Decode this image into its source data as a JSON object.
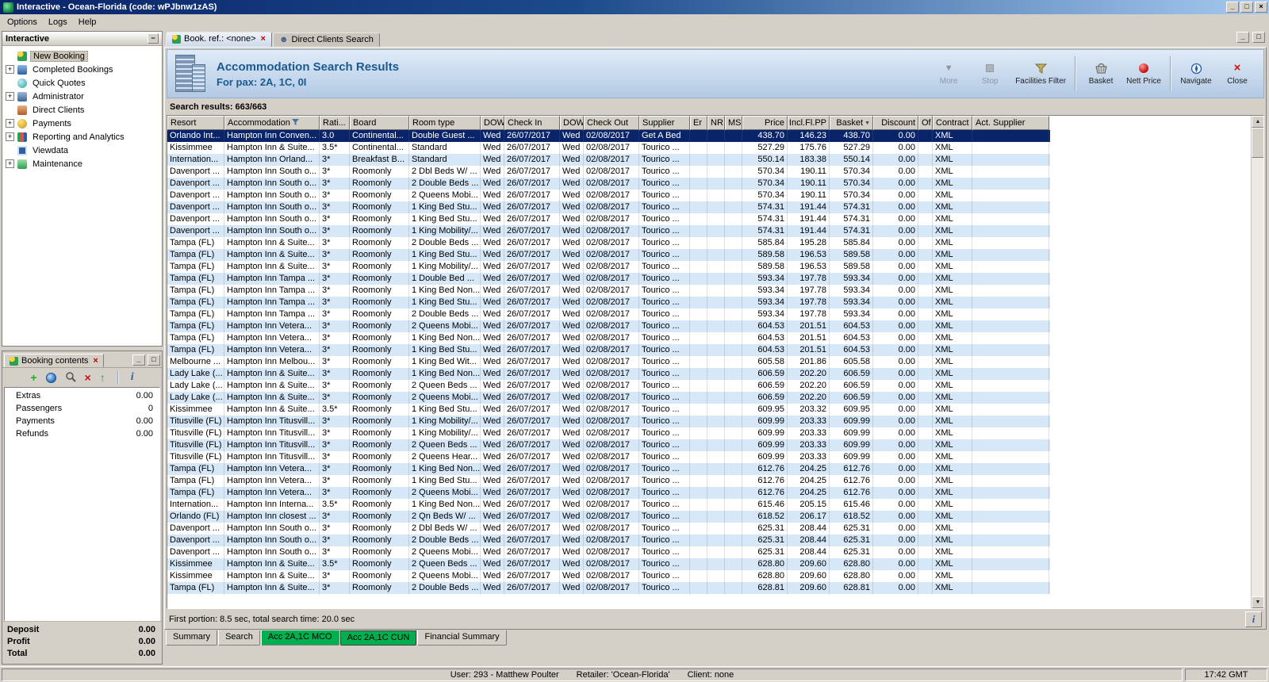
{
  "window": {
    "title": "Interactive - Ocean-Florida (code: wPJbnw1zAS)",
    "menu": [
      "Options",
      "Logs",
      "Help"
    ],
    "time": "17:42 GMT"
  },
  "sidebar": {
    "title": "Interactive",
    "items": [
      {
        "label": "New Booking",
        "icon": "new-booking",
        "expandable": false,
        "selected": true
      },
      {
        "label": "Completed Bookings",
        "icon": "completed-bookings",
        "expandable": true,
        "selected": false
      },
      {
        "label": "Quick Quotes",
        "icon": "quick-quotes",
        "expandable": false,
        "selected": false
      },
      {
        "label": "Administrator",
        "icon": "administrator",
        "expandable": true,
        "selected": false
      },
      {
        "label": "Direct Clients",
        "icon": "direct-clients",
        "expandable": false,
        "selected": false
      },
      {
        "label": "Payments",
        "icon": "payments",
        "expandable": true,
        "selected": false
      },
      {
        "label": "Reporting and Analytics",
        "icon": "reporting",
        "expandable": true,
        "selected": false
      },
      {
        "label": "Viewdata",
        "icon": "viewdata",
        "expandable": false,
        "selected": false
      },
      {
        "label": "Maintenance",
        "icon": "maintenance",
        "expandable": true,
        "selected": false
      }
    ]
  },
  "booking_contents": {
    "title": "Booking contents",
    "rows": [
      [
        "Extras",
        "0.00"
      ],
      [
        "Passengers",
        "0"
      ],
      [
        "Payments",
        "0.00"
      ],
      [
        "Refunds",
        "0.00"
      ]
    ],
    "totals": [
      [
        "Deposit",
        "0.00"
      ],
      [
        "Profit",
        "0.00"
      ],
      [
        "Total",
        "0.00"
      ]
    ]
  },
  "tabs": [
    {
      "label": "Book. ref.: <none>",
      "active": true,
      "closable": true,
      "icon": "palm-tree"
    },
    {
      "label": "Direct Clients Search",
      "active": false,
      "closable": false,
      "icon": "person"
    }
  ],
  "header": {
    "title": "Accommodation Search Results",
    "subtitle": "For pax: 2A, 1C, 0I",
    "toolbar": [
      {
        "label": "More",
        "icon": "more",
        "disabled": true,
        "sep_before": false
      },
      {
        "label": "Stop",
        "icon": "stop",
        "disabled": true,
        "sep_before": false
      },
      {
        "label": "Facilities Filter",
        "icon": "facilities-filter",
        "disabled": false,
        "sep_before": false
      },
      {
        "label": "Basket",
        "icon": "basket",
        "disabled": false,
        "sep_before": true
      },
      {
        "label": "Nett Price",
        "icon": "nett-price",
        "disabled": false,
        "sep_before": false
      },
      {
        "label": "Navigate",
        "icon": "navigate",
        "disabled": false,
        "sep_before": true
      },
      {
        "label": "Close",
        "icon": "close",
        "disabled": false,
        "sep_before": false
      }
    ]
  },
  "results": {
    "summary": "Search results: 663/663",
    "status": "First portion: 8.5 sec, total search time: 20.0 sec",
    "columns": [
      "Resort",
      "Accommodation",
      "Rati...",
      "Board",
      "Room type",
      "DOW",
      "Check In",
      "DOW",
      "Check Out",
      "Supplier",
      "Er",
      "NR",
      "MS",
      "Price",
      "Incl.Fl.PP",
      "Basket",
      "Discount",
      "Of",
      "Contract",
      "Act. Supplier"
    ],
    "rows": [
      [
        "Orlando Int...",
        "Hampton Inn Conven...",
        "3.0",
        "Continental...",
        "Double Guest ...",
        "Wed",
        "26/07/2017",
        "Wed",
        "02/08/2017",
        "Get A Bed",
        "438.70",
        "146.23",
        "438.70",
        "0.00",
        "XML"
      ],
      [
        "Kissimmee",
        "Hampton Inn & Suite...",
        "3.5*",
        "Continental...",
        "Standard",
        "Wed",
        "26/07/2017",
        "Wed",
        "02/08/2017",
        "Tourico ...",
        "527.29",
        "175.76",
        "527.29",
        "0.00",
        "XML"
      ],
      [
        "Internation...",
        "Hampton Inn Orland...",
        "3*",
        "Breakfast B...",
        "Standard",
        "Wed",
        "26/07/2017",
        "Wed",
        "02/08/2017",
        "Tourico ...",
        "550.14",
        "183.38",
        "550.14",
        "0.00",
        "XML"
      ],
      [
        "Davenport ...",
        "Hampton Inn South o...",
        "3*",
        "Roomonly",
        "2 Dbl Beds W/ ...",
        "Wed",
        "26/07/2017",
        "Wed",
        "02/08/2017",
        "Tourico ...",
        "570.34",
        "190.11",
        "570.34",
        "0.00",
        "XML"
      ],
      [
        "Davenport ...",
        "Hampton Inn South o...",
        "3*",
        "Roomonly",
        "2 Double Beds ...",
        "Wed",
        "26/07/2017",
        "Wed",
        "02/08/2017",
        "Tourico ...",
        "570.34",
        "190.11",
        "570.34",
        "0.00",
        "XML"
      ],
      [
        "Davenport ...",
        "Hampton Inn South o...",
        "3*",
        "Roomonly",
        "2 Queens Mobi...",
        "Wed",
        "26/07/2017",
        "Wed",
        "02/08/2017",
        "Tourico ...",
        "570.34",
        "190.11",
        "570.34",
        "0.00",
        "XML"
      ],
      [
        "Davenport ...",
        "Hampton Inn South o...",
        "3*",
        "Roomonly",
        "1 King Bed Stu...",
        "Wed",
        "26/07/2017",
        "Wed",
        "02/08/2017",
        "Tourico ...",
        "574.31",
        "191.44",
        "574.31",
        "0.00",
        "XML"
      ],
      [
        "Davenport ...",
        "Hampton Inn South o...",
        "3*",
        "Roomonly",
        "1 King Bed Stu...",
        "Wed",
        "26/07/2017",
        "Wed",
        "02/08/2017",
        "Tourico ...",
        "574.31",
        "191.44",
        "574.31",
        "0.00",
        "XML"
      ],
      [
        "Davenport ...",
        "Hampton Inn South o...",
        "3*",
        "Roomonly",
        "1 King Mobility/...",
        "Wed",
        "26/07/2017",
        "Wed",
        "02/08/2017",
        "Tourico ...",
        "574.31",
        "191.44",
        "574.31",
        "0.00",
        "XML"
      ],
      [
        "Tampa (FL)",
        "Hampton Inn & Suite...",
        "3*",
        "Roomonly",
        "2 Double Beds ...",
        "Wed",
        "26/07/2017",
        "Wed",
        "02/08/2017",
        "Tourico ...",
        "585.84",
        "195.28",
        "585.84",
        "0.00",
        "XML"
      ],
      [
        "Tampa (FL)",
        "Hampton Inn & Suite...",
        "3*",
        "Roomonly",
        "1 King Bed Stu...",
        "Wed",
        "26/07/2017",
        "Wed",
        "02/08/2017",
        "Tourico ...",
        "589.58",
        "196.53",
        "589.58",
        "0.00",
        "XML"
      ],
      [
        "Tampa (FL)",
        "Hampton Inn & Suite...",
        "3*",
        "Roomonly",
        "1 King Mobility/...",
        "Wed",
        "26/07/2017",
        "Wed",
        "02/08/2017",
        "Tourico ...",
        "589.58",
        "196.53",
        "589.58",
        "0.00",
        "XML"
      ],
      [
        "Tampa (FL)",
        "Hampton Inn Tampa ...",
        "3*",
        "Roomonly",
        "1 Double Bed ...",
        "Wed",
        "26/07/2017",
        "Wed",
        "02/08/2017",
        "Tourico ...",
        "593.34",
        "197.78",
        "593.34",
        "0.00",
        "XML"
      ],
      [
        "Tampa (FL)",
        "Hampton Inn Tampa ...",
        "3*",
        "Roomonly",
        "1 King Bed Non...",
        "Wed",
        "26/07/2017",
        "Wed",
        "02/08/2017",
        "Tourico ...",
        "593.34",
        "197.78",
        "593.34",
        "0.00",
        "XML"
      ],
      [
        "Tampa (FL)",
        "Hampton Inn Tampa ...",
        "3*",
        "Roomonly",
        "1 King Bed Stu...",
        "Wed",
        "26/07/2017",
        "Wed",
        "02/08/2017",
        "Tourico ...",
        "593.34",
        "197.78",
        "593.34",
        "0.00",
        "XML"
      ],
      [
        "Tampa (FL)",
        "Hampton Inn Tampa ...",
        "3*",
        "Roomonly",
        "2 Double Beds ...",
        "Wed",
        "26/07/2017",
        "Wed",
        "02/08/2017",
        "Tourico ...",
        "593.34",
        "197.78",
        "593.34",
        "0.00",
        "XML"
      ],
      [
        "Tampa (FL)",
        "Hampton Inn Vetera...",
        "3*",
        "Roomonly",
        "2 Queens Mobi...",
        "Wed",
        "26/07/2017",
        "Wed",
        "02/08/2017",
        "Tourico ...",
        "604.53",
        "201.51",
        "604.53",
        "0.00",
        "XML"
      ],
      [
        "Tampa (FL)",
        "Hampton Inn Vetera...",
        "3*",
        "Roomonly",
        "1 King Bed Non...",
        "Wed",
        "26/07/2017",
        "Wed",
        "02/08/2017",
        "Tourico ...",
        "604.53",
        "201.51",
        "604.53",
        "0.00",
        "XML"
      ],
      [
        "Tampa (FL)",
        "Hampton Inn Vetera...",
        "3*",
        "Roomonly",
        "1 King Bed Stu...",
        "Wed",
        "26/07/2017",
        "Wed",
        "02/08/2017",
        "Tourico ...",
        "604.53",
        "201.51",
        "604.53",
        "0.00",
        "XML"
      ],
      [
        "Melbourne ...",
        "Hampton Inn Melbou...",
        "3*",
        "Roomonly",
        "1 King Bed Wit...",
        "Wed",
        "26/07/2017",
        "Wed",
        "02/08/2017",
        "Tourico ...",
        "605.58",
        "201.86",
        "605.58",
        "0.00",
        "XML"
      ],
      [
        "Lady Lake (...",
        "Hampton Inn & Suite...",
        "3*",
        "Roomonly",
        "1 King Bed Non...",
        "Wed",
        "26/07/2017",
        "Wed",
        "02/08/2017",
        "Tourico ...",
        "606.59",
        "202.20",
        "606.59",
        "0.00",
        "XML"
      ],
      [
        "Lady Lake (...",
        "Hampton Inn & Suite...",
        "3*",
        "Roomonly",
        "2 Queen Beds ...",
        "Wed",
        "26/07/2017",
        "Wed",
        "02/08/2017",
        "Tourico ...",
        "606.59",
        "202.20",
        "606.59",
        "0.00",
        "XML"
      ],
      [
        "Lady Lake (...",
        "Hampton Inn & Suite...",
        "3*",
        "Roomonly",
        "2 Queens Mobi...",
        "Wed",
        "26/07/2017",
        "Wed",
        "02/08/2017",
        "Tourico ...",
        "606.59",
        "202.20",
        "606.59",
        "0.00",
        "XML"
      ],
      [
        "Kissimmee",
        "Hampton Inn & Suite...",
        "3.5*",
        "Roomonly",
        "1 King Bed Stu...",
        "Wed",
        "26/07/2017",
        "Wed",
        "02/08/2017",
        "Tourico ...",
        "609.95",
        "203.32",
        "609.95",
        "0.00",
        "XML"
      ],
      [
        "Titusville (FL)",
        "Hampton Inn Titusvill...",
        "3*",
        "Roomonly",
        "1 King Mobility/...",
        "Wed",
        "26/07/2017",
        "Wed",
        "02/08/2017",
        "Tourico ...",
        "609.99",
        "203.33",
        "609.99",
        "0.00",
        "XML"
      ],
      [
        "Titusville (FL)",
        "Hampton Inn Titusvill...",
        "3*",
        "Roomonly",
        "1 King Mobility/...",
        "Wed",
        "26/07/2017",
        "Wed",
        "02/08/2017",
        "Tourico ...",
        "609.99",
        "203.33",
        "609.99",
        "0.00",
        "XML"
      ],
      [
        "Titusville (FL)",
        "Hampton Inn Titusvill...",
        "3*",
        "Roomonly",
        "2 Queen Beds ...",
        "Wed",
        "26/07/2017",
        "Wed",
        "02/08/2017",
        "Tourico ...",
        "609.99",
        "203.33",
        "609.99",
        "0.00",
        "XML"
      ],
      [
        "Titusville (FL)",
        "Hampton Inn Titusvill...",
        "3*",
        "Roomonly",
        "2 Queens Hear...",
        "Wed",
        "26/07/2017",
        "Wed",
        "02/08/2017",
        "Tourico ...",
        "609.99",
        "203.33",
        "609.99",
        "0.00",
        "XML"
      ],
      [
        "Tampa (FL)",
        "Hampton Inn Vetera...",
        "3*",
        "Roomonly",
        "1 King Bed Non...",
        "Wed",
        "26/07/2017",
        "Wed",
        "02/08/2017",
        "Tourico ...",
        "612.76",
        "204.25",
        "612.76",
        "0.00",
        "XML"
      ],
      [
        "Tampa (FL)",
        "Hampton Inn Vetera...",
        "3*",
        "Roomonly",
        "1 King Bed Stu...",
        "Wed",
        "26/07/2017",
        "Wed",
        "02/08/2017",
        "Tourico ...",
        "612.76",
        "204.25",
        "612.76",
        "0.00",
        "XML"
      ],
      [
        "Tampa (FL)",
        "Hampton Inn Vetera...",
        "3*",
        "Roomonly",
        "2 Queens Mobi...",
        "Wed",
        "26/07/2017",
        "Wed",
        "02/08/2017",
        "Tourico ...",
        "612.76",
        "204.25",
        "612.76",
        "0.00",
        "XML"
      ],
      [
        "Internation...",
        "Hampton Inn Interna...",
        "3.5*",
        "Roomonly",
        "1 King Bed Non...",
        "Wed",
        "26/07/2017",
        "Wed",
        "02/08/2017",
        "Tourico ...",
        "615.46",
        "205.15",
        "615.46",
        "0.00",
        "XML"
      ],
      [
        "Orlando (FL)",
        "Hampton Inn closest ...",
        "3*",
        "Roomonly",
        "2 Qn Beds W/ ...",
        "Wed",
        "26/07/2017",
        "Wed",
        "02/08/2017",
        "Tourico ...",
        "618.52",
        "206.17",
        "618.52",
        "0.00",
        "XML"
      ],
      [
        "Davenport ...",
        "Hampton Inn South o...",
        "3*",
        "Roomonly",
        "2 Dbl Beds W/ ...",
        "Wed",
        "26/07/2017",
        "Wed",
        "02/08/2017",
        "Tourico ...",
        "625.31",
        "208.44",
        "625.31",
        "0.00",
        "XML"
      ],
      [
        "Davenport ...",
        "Hampton Inn South o...",
        "3*",
        "Roomonly",
        "2 Double Beds ...",
        "Wed",
        "26/07/2017",
        "Wed",
        "02/08/2017",
        "Tourico ...",
        "625.31",
        "208.44",
        "625.31",
        "0.00",
        "XML"
      ],
      [
        "Davenport ...",
        "Hampton Inn South o...",
        "3*",
        "Roomonly",
        "2 Queens Mobi...",
        "Wed",
        "26/07/2017",
        "Wed",
        "02/08/2017",
        "Tourico ...",
        "625.31",
        "208.44",
        "625.31",
        "0.00",
        "XML"
      ],
      [
        "Kissimmee",
        "Hampton Inn & Suite...",
        "3.5*",
        "Roomonly",
        "2 Queen Beds ...",
        "Wed",
        "26/07/2017",
        "Wed",
        "02/08/2017",
        "Tourico ...",
        "628.80",
        "209.60",
        "628.80",
        "0.00",
        "XML"
      ],
      [
        "Kissimmee",
        "Hampton Inn & Suite...",
        "3*",
        "Roomonly",
        "2 Queens Mobi...",
        "Wed",
        "26/07/2017",
        "Wed",
        "02/08/2017",
        "Tourico ...",
        "628.80",
        "209.60",
        "628.80",
        "0.00",
        "XML"
      ],
      [
        "Tampa (FL)",
        "Hampton Inn & Suite...",
        "3*",
        "Roomonly",
        "2 Double Beds ...",
        "Wed",
        "26/07/2017",
        "Wed",
        "02/08/2017",
        "Tourico ...",
        "628.81",
        "209.60",
        "628.81",
        "0.00",
        "XML"
      ]
    ]
  },
  "bottom_tabs": [
    {
      "label": "Summary",
      "color": "",
      "active": false
    },
    {
      "label": "Search",
      "color": "",
      "active": false
    },
    {
      "label": "Acc 2A,1C MCO",
      "color": "#00b050",
      "active": false
    },
    {
      "label": "Acc 2A,1C CUN",
      "color": "#00b050",
      "active": true
    },
    {
      "label": "Financial Summary",
      "color": "",
      "active": false
    }
  ],
  "statusbar": {
    "user": "User: 293 - Matthew Poulter",
    "retailer": "Retailer: 'Ocean-Florida'",
    "client": "Client: none"
  }
}
